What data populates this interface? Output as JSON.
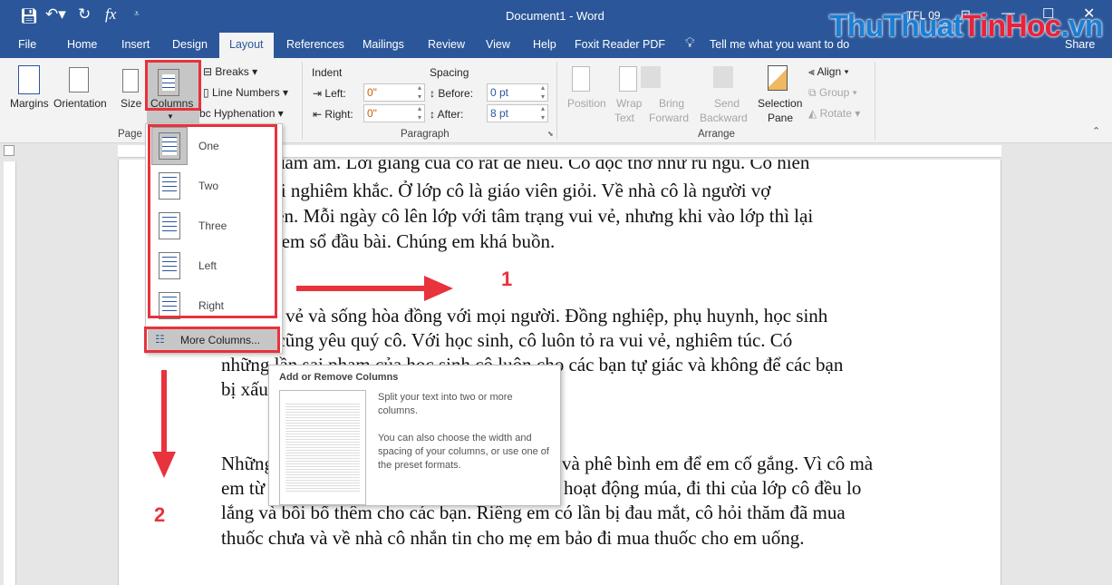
{
  "titlebar": {
    "title": "Document1  -  Word",
    "user": "TFL 09",
    "qat": [
      "save-icon",
      "undo-icon",
      "redo-icon",
      "fx-icon",
      "customize-icon"
    ]
  },
  "watermark": {
    "part1": "ThuThuat",
    "part2": "TinHoc",
    "part3": ".vn"
  },
  "tabs": [
    "File",
    "Home",
    "Insert",
    "Design",
    "Layout",
    "References",
    "Mailings",
    "Review",
    "View",
    "Help",
    "Foxit Reader PDF"
  ],
  "active_tab": "Layout",
  "tell_me": "Tell me what you want to do",
  "share": "Share",
  "ribbon": {
    "page_setup": {
      "label": "Page Setup",
      "margins": "Margins",
      "orientation": "Orientation",
      "size": "Size",
      "columns": "Columns",
      "breaks": "Breaks",
      "line_numbers": "Line Numbers",
      "hyphenation": "Hyphenation"
    },
    "paragraph": {
      "label": "Paragraph",
      "indent": "Indent",
      "spacing": "Spacing",
      "left_label": "Left:",
      "left_value": "0\"",
      "right_label": "Right:",
      "right_value": "0\"",
      "before_label": "Before:",
      "before_value": "0 pt",
      "after_label": "After:",
      "after_value": "8 pt"
    },
    "arrange": {
      "label": "Arrange",
      "position": [
        "Position",
        ""
      ],
      "wrap_text": [
        "Wrap",
        "Text"
      ],
      "bring_forward": [
        "Bring",
        "Forward"
      ],
      "send_backward": [
        "Send",
        "Backward"
      ],
      "selection_pane": [
        "Selection",
        "Pane"
      ],
      "align": "Align",
      "group": "Group",
      "rotate": "Rotate"
    }
  },
  "columns_menu": {
    "items": [
      "One",
      "Two",
      "Three",
      "Left",
      "Right"
    ],
    "selected": "One",
    "more": "More Columns..."
  },
  "tooltip": {
    "title": "Add or Remove Columns",
    "text1": "Split your text into two or more columns.",
    "text2": "You can also choose the width and spacing of your columns, or use one of the preset formats."
  },
  "annotations": {
    "step1": "1",
    "step2": "2",
    "color": "#e8323c"
  },
  "document": {
    "lines": [
      "ôi rất đầm ấm. Lời giảng của cô rất dễ hiểu. Cô đọc thơ như ru ngủ. Cô hiền",
      "ưng lại nghiêm khắc. Ở lớp cô là giáo viên giỏi. Về nhà cô là người vợ",
      "mẹ hiền. Mỗi ngày cô lên lớp với tâm trạng vui vẻ, nhưng khi vào lớp thì lại",
      "i khi xem sổ đầu bài. Chúng em khá buồn.",
      "vui vẻ và sống hòa đồng với mọi người. Đồng nghiệp, phụ huynh, học sinh",
      "ai cũng yêu quý cô. Với học sinh, cô luôn tỏ ra vui vẻ, nghiêm túc. Có",
      "những lần sai phạm của học sinh cô luôn cho các bạn tự giác và không để các bạn",
      "bị xấu",
      "Những",
      "và phê bình em để em cố gắng. Vì cô mà",
      "em từ",
      "hoạt động múa, đi thi của lớp cô đều lo",
      "lắng và bồi bổ thêm cho các bạn. Riêng em có lần bị đau mắt, cô hỏi thăm đã mua",
      "thuốc chưa và về nhà cô nhắn tin cho mẹ em bảo đi mua thuốc cho em uống."
    ]
  },
  "colors": {
    "word_blue": "#2b579a",
    "ribbon_bg": "#f3f3f3",
    "highlight": "#e8323c"
  }
}
